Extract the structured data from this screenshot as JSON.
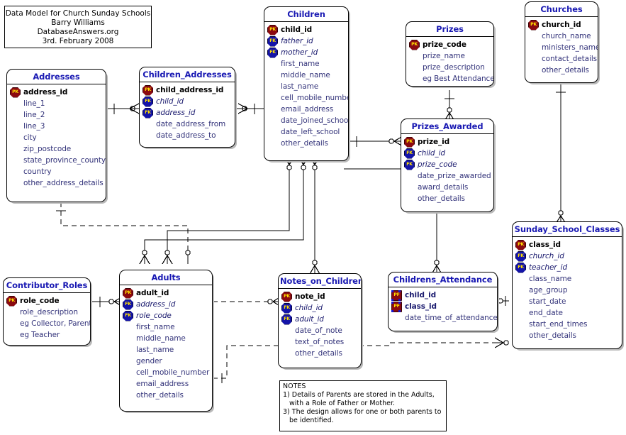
{
  "diagram": {
    "title_box": {
      "lines": [
        "Data Model for Church Sunday Schools",
        "Barry Williams",
        "DatabaseAnswers.org",
        "3rd. February 2008"
      ]
    },
    "notes_box": {
      "heading": "NOTES",
      "lines": [
        "1) Details of Parents are stored in the Adults,",
        "with a Role of Father or Mother.",
        "3) The design allows for one or both parents to",
        "be identified."
      ]
    },
    "colors": {
      "entity_title": "#1919b3",
      "attribute_text": "#1a1a6e",
      "pk_badge": "#8b0a10",
      "fk_badge": "#1414a8",
      "pf_badge": "#8b0a10",
      "badge_label": "#ffe000",
      "line": "#000000",
      "shadow": "#b9b9b9",
      "background": "#ffffff"
    },
    "entities": [
      {
        "name": "Addresses",
        "attributes": [
          {
            "key": "PK",
            "name": "address_id"
          },
          {
            "key": "",
            "name": "line_1"
          },
          {
            "key": "",
            "name": "line_2"
          },
          {
            "key": "",
            "name": "line_3"
          },
          {
            "key": "",
            "name": "city"
          },
          {
            "key": "",
            "name": "zip_postcode"
          },
          {
            "key": "",
            "name": "state_province_county"
          },
          {
            "key": "",
            "name": "country"
          },
          {
            "key": "",
            "name": "other_address_details"
          }
        ]
      },
      {
        "name": "Children_Addresses",
        "attributes": [
          {
            "key": "PK",
            "name": "child_address_id"
          },
          {
            "key": "FK",
            "name": "child_id"
          },
          {
            "key": "FK",
            "name": "address_id"
          },
          {
            "key": "",
            "name": "date_address_from"
          },
          {
            "key": "",
            "name": "date_address_to"
          }
        ]
      },
      {
        "name": "Children",
        "attributes": [
          {
            "key": "PK",
            "name": "child_id"
          },
          {
            "key": "FK",
            "name": "father_id"
          },
          {
            "key": "FK",
            "name": "mother_id"
          },
          {
            "key": "",
            "name": "first_name"
          },
          {
            "key": "",
            "name": "middle_name"
          },
          {
            "key": "",
            "name": "last_name"
          },
          {
            "key": "",
            "name": "cell_mobile_number"
          },
          {
            "key": "",
            "name": "email_address"
          },
          {
            "key": "",
            "name": "date_joined_school"
          },
          {
            "key": "",
            "name": "date_left_school"
          },
          {
            "key": "",
            "name": "other_details"
          }
        ]
      },
      {
        "name": "Prizes",
        "attributes": [
          {
            "key": "PK",
            "name": "prize_code"
          },
          {
            "key": "",
            "name": "prize_name"
          },
          {
            "key": "",
            "name": "prize_description"
          },
          {
            "key": "",
            "name": "eg Best Attendance"
          }
        ]
      },
      {
        "name": "Churches",
        "attributes": [
          {
            "key": "PK",
            "name": "church_id"
          },
          {
            "key": "",
            "name": "church_name"
          },
          {
            "key": "",
            "name": "ministers_name"
          },
          {
            "key": "",
            "name": "contact_details"
          },
          {
            "key": "",
            "name": "other_details"
          }
        ]
      },
      {
        "name": "Prizes_Awarded",
        "attributes": [
          {
            "key": "PK",
            "name": "prize_id"
          },
          {
            "key": "FK",
            "name": "child_id"
          },
          {
            "key": "FK",
            "name": "prize_code"
          },
          {
            "key": "",
            "name": "date_prize_awarded"
          },
          {
            "key": "",
            "name": "award_details"
          },
          {
            "key": "",
            "name": "other_details"
          }
        ]
      },
      {
        "name": "Sunday_School_Classes",
        "attributes": [
          {
            "key": "PK",
            "name": "class_id"
          },
          {
            "key": "FK",
            "name": "church_id"
          },
          {
            "key": "FK",
            "name": "teacher_id"
          },
          {
            "key": "",
            "name": "class_name"
          },
          {
            "key": "",
            "name": "age_group"
          },
          {
            "key": "",
            "name": "start_date"
          },
          {
            "key": "",
            "name": "end_date"
          },
          {
            "key": "",
            "name": "start_end_times"
          },
          {
            "key": "",
            "name": "other_details"
          }
        ]
      },
      {
        "name": "Contributor_Roles",
        "attributes": [
          {
            "key": "PK",
            "name": "role_code"
          },
          {
            "key": "",
            "name": "role_description"
          },
          {
            "key": "",
            "name": "eg Collector, Parent"
          },
          {
            "key": "",
            "name": "eg Teacher"
          }
        ]
      },
      {
        "name": "Adults",
        "attributes": [
          {
            "key": "PK",
            "name": "adult_id"
          },
          {
            "key": "FK",
            "name": "address_id"
          },
          {
            "key": "FK",
            "name": "role_code"
          },
          {
            "key": "",
            "name": "first_name"
          },
          {
            "key": "",
            "name": "middle_name"
          },
          {
            "key": "",
            "name": "last_name"
          },
          {
            "key": "",
            "name": "gender"
          },
          {
            "key": "",
            "name": "cell_mobile_number"
          },
          {
            "key": "",
            "name": "email_address"
          },
          {
            "key": "",
            "name": "other_details"
          }
        ]
      },
      {
        "name": "Notes_on_Children",
        "attributes": [
          {
            "key": "PK",
            "name": "note_id"
          },
          {
            "key": "FK",
            "name": "child_id"
          },
          {
            "key": "FK",
            "name": "adult_id"
          },
          {
            "key": "",
            "name": "date_of_note"
          },
          {
            "key": "",
            "name": "text_of_notes"
          },
          {
            "key": "",
            "name": "other_details"
          }
        ]
      },
      {
        "name": "Childrens_Attendance",
        "attributes": [
          {
            "key": "PF",
            "name": "child_id"
          },
          {
            "key": "PF",
            "name": "class_id"
          },
          {
            "key": "",
            "name": "date_time_of_attendance"
          }
        ]
      }
    ],
    "relationships": [
      {
        "from": "Addresses",
        "to": "Children_Addresses",
        "style": "solid"
      },
      {
        "from": "Children",
        "to": "Children_Addresses",
        "style": "solid"
      },
      {
        "from": "Children",
        "to": "Prizes_Awarded",
        "style": "solid"
      },
      {
        "from": "Prizes",
        "to": "Prizes_Awarded",
        "style": "solid"
      },
      {
        "from": "Children",
        "to": "Notes_on_Children",
        "style": "solid"
      },
      {
        "from": "Children",
        "to": "Childrens_Attendance",
        "style": "solid"
      },
      {
        "from": "Children",
        "to": "Adults",
        "style": "solid"
      },
      {
        "from": "Addresses",
        "to": "Adults",
        "style": "dashed"
      },
      {
        "from": "Contributor_Roles",
        "to": "Adults",
        "style": "solid"
      },
      {
        "from": "Adults",
        "to": "Notes_on_Children",
        "style": "dashed"
      },
      {
        "from": "Adults",
        "to": "Sunday_School_Classes",
        "style": "dashed"
      },
      {
        "from": "Churches",
        "to": "Sunday_School_Classes",
        "style": "solid"
      },
      {
        "from": "Childrens_Attendance",
        "to": "Sunday_School_Classes",
        "style": "solid"
      }
    ]
  }
}
